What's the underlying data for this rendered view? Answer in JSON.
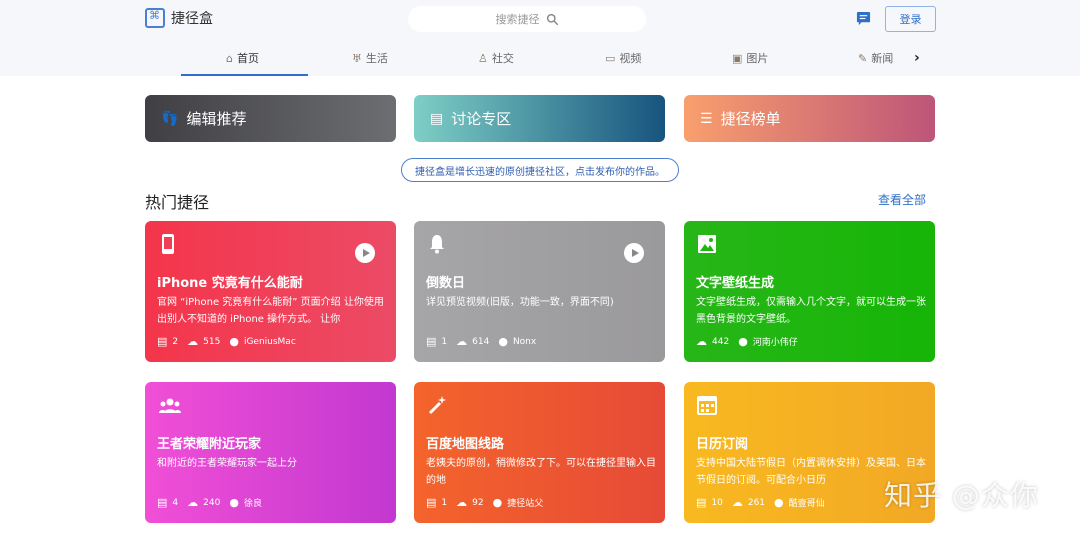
{
  "header": {
    "logo_text": "捷径盒",
    "search_placeholder": "搜索捷径",
    "login_label": "登录"
  },
  "tabs": [
    {
      "label": "首页",
      "icon": "home-icon",
      "active": true
    },
    {
      "label": "生活",
      "icon": "cup-icon"
    },
    {
      "label": "社交",
      "icon": "people-icon"
    },
    {
      "label": "视频",
      "icon": "video-icon"
    },
    {
      "label": "图片",
      "icon": "picture-icon"
    },
    {
      "label": "新闻",
      "icon": "news-icon"
    }
  ],
  "categories": [
    {
      "label": "编辑推荐",
      "icon": "footprints-icon"
    },
    {
      "label": "讨论专区",
      "icon": "chat-icon"
    },
    {
      "label": "捷径榜单",
      "icon": "list-icon"
    }
  ],
  "notice": "捷径盒是增长迅速的原创捷径社区，点击发布你的作品。",
  "section": {
    "title": "热门捷径",
    "see_all": "查看全部"
  },
  "cards": [
    {
      "title": "iPhone 究竟有什么能耐",
      "desc": "官网 “iPhone 究竟有什么能耐” 页面介绍 让你使用出别人不知道的 iPhone 操作方式。 让你",
      "comments": "2",
      "downloads": "515",
      "author": "iGeniusMac",
      "icon": "phone-icon",
      "play": true
    },
    {
      "title": "倒数日",
      "desc": "详见预览视频(旧版，功能一致，界面不同)",
      "comments": "1",
      "downloads": "614",
      "author": "Nonx",
      "icon": "bell-icon",
      "play": true
    },
    {
      "title": "文字壁纸生成",
      "desc": "文字壁纸生成，仅需输入几个文字，就可以生成一张黑色背景的文字壁纸。",
      "comments": "",
      "downloads": "442",
      "author": "河南小伟仔",
      "icon": "image-icon",
      "play": false
    },
    {
      "title": "王者荣耀附近玩家",
      "desc": "和附近的王者荣耀玩家一起上分",
      "comments": "4",
      "downloads": "240",
      "author": "徐良",
      "icon": "group-icon",
      "play": false
    },
    {
      "title": "百度地图线路",
      "desc": "老姨夫的原创，稍微修改了下。可以在捷径里输入目的地",
      "comments": "1",
      "downloads": "92",
      "author": "捷径站父",
      "icon": "magic-wand-icon",
      "play": false
    },
    {
      "title": "日历订阅",
      "desc": "支持中国大陆节假日（内置调休安排）及美国、日本节假日的订阅。可配合小日历",
      "comments": "10",
      "downloads": "261",
      "author": "酷壹哥仙",
      "icon": "calendar-icon",
      "play": false
    }
  ],
  "watermark": "知乎 @众你"
}
